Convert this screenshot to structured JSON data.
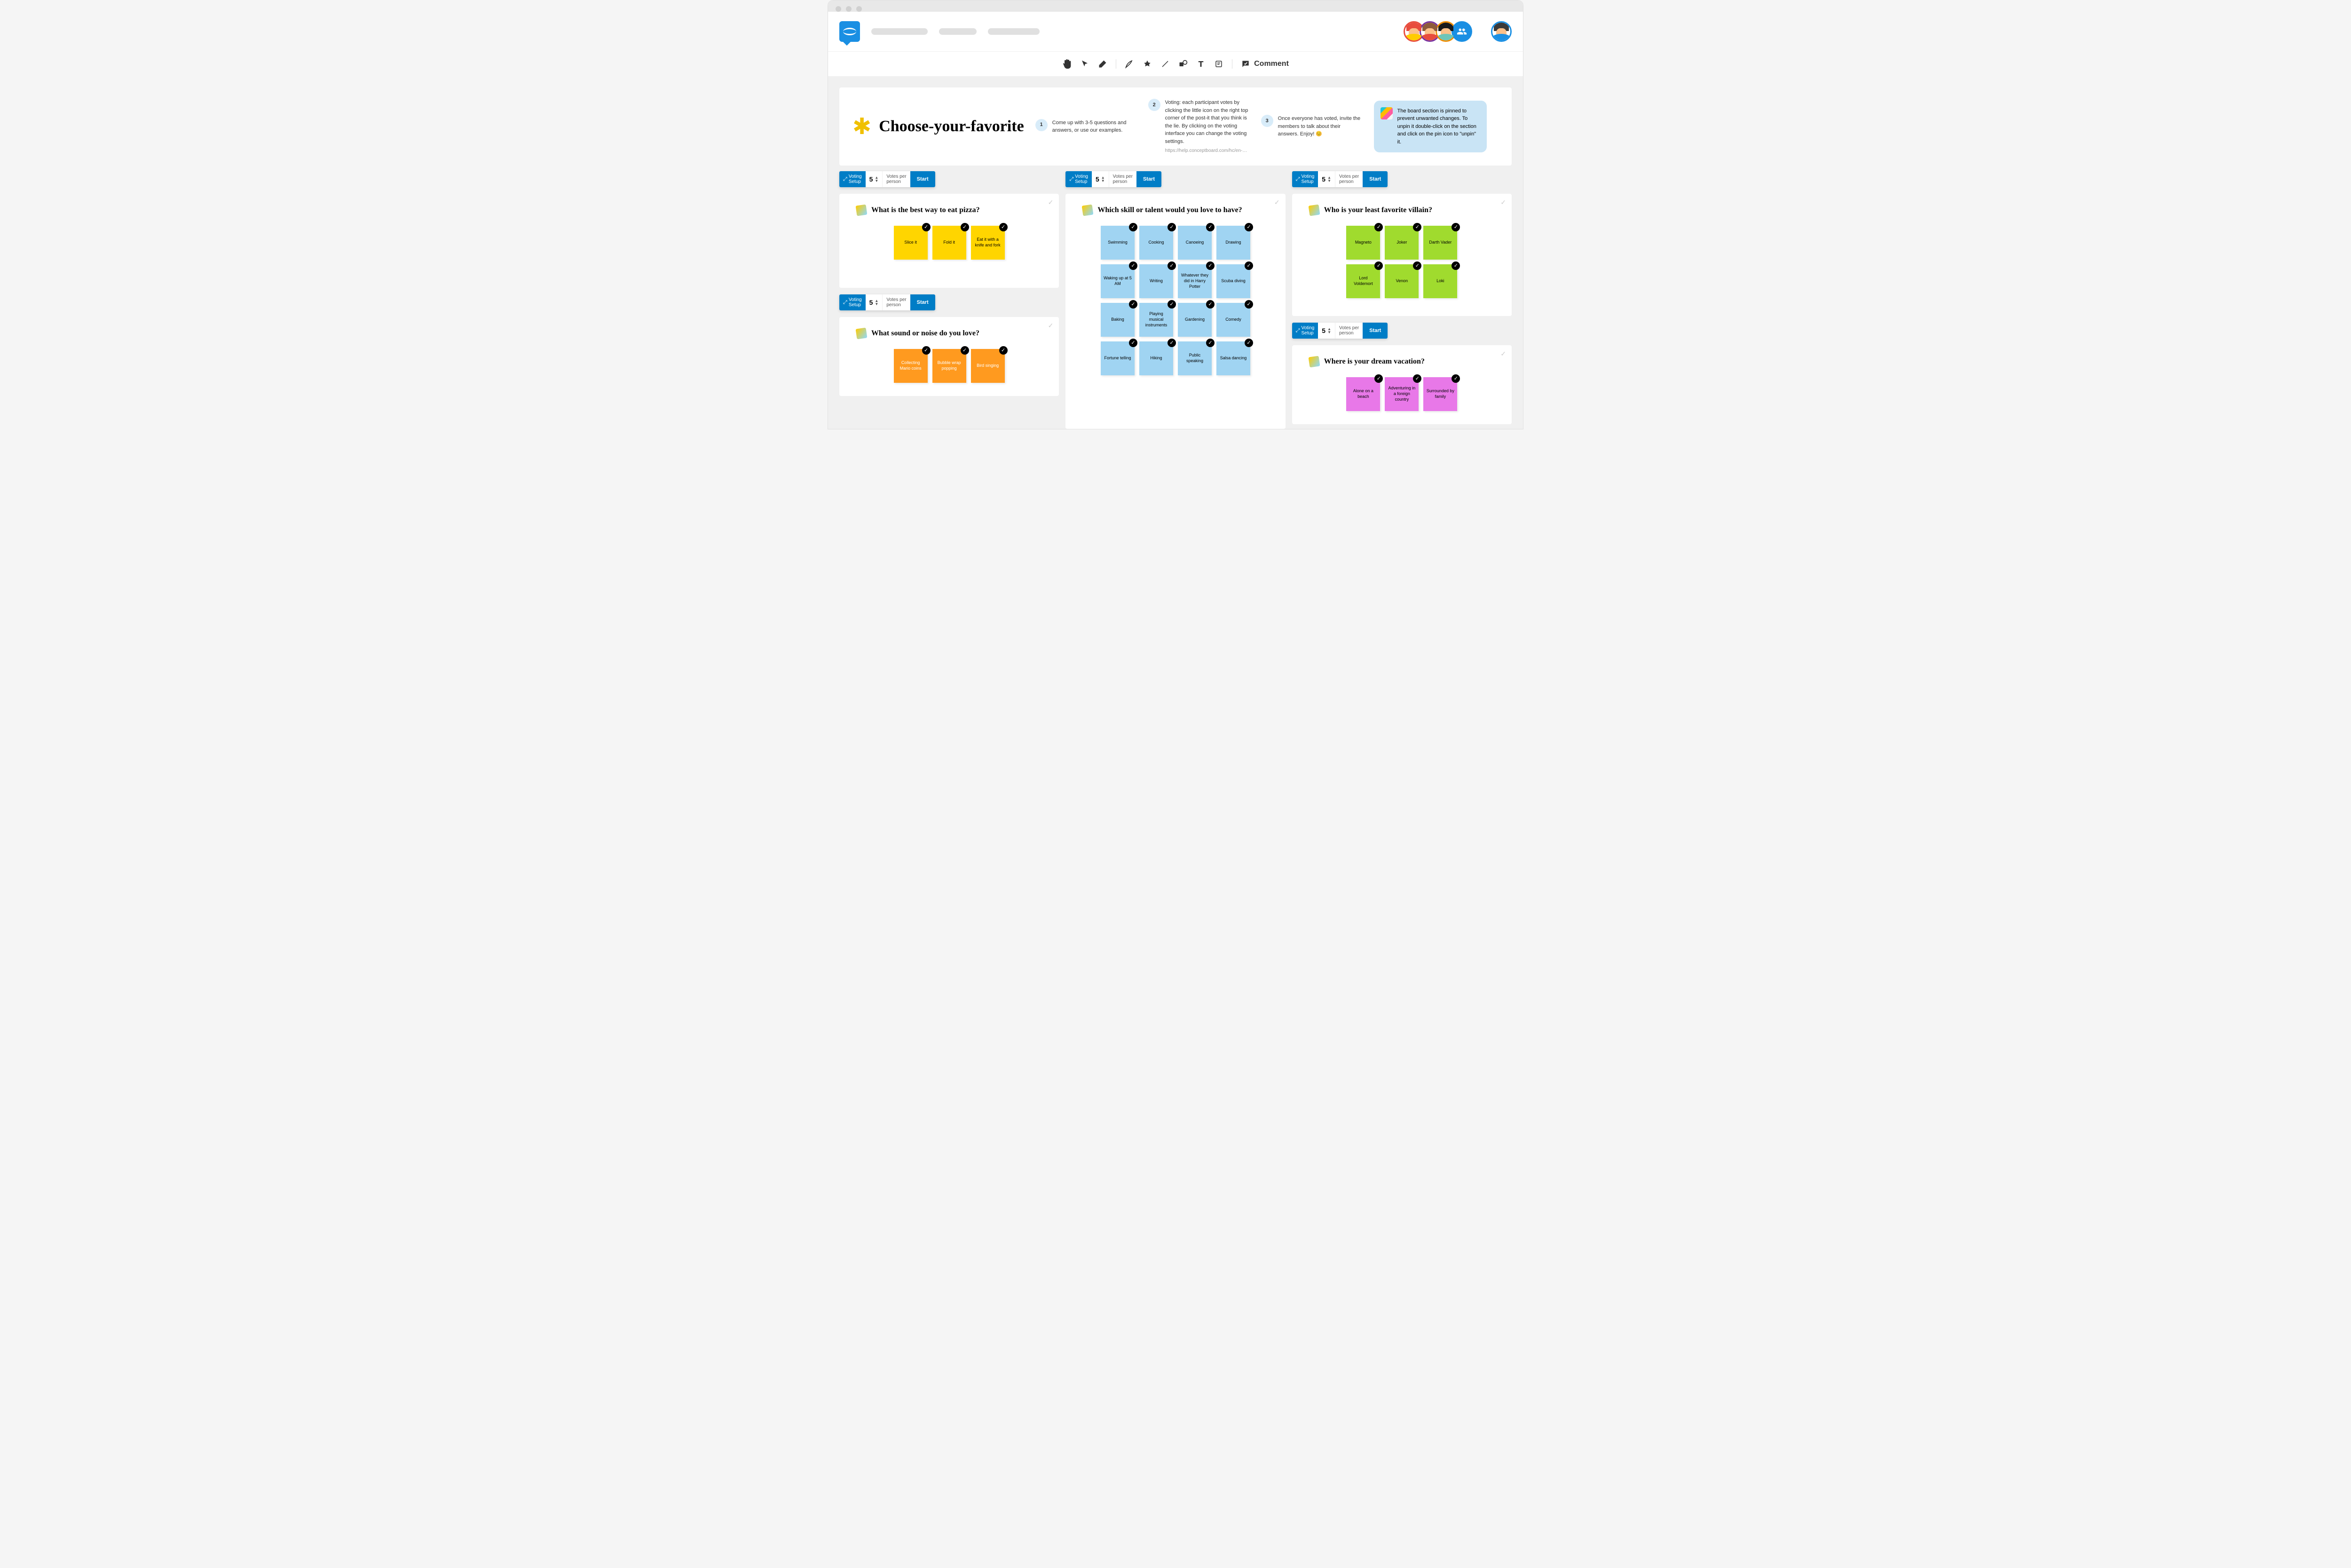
{
  "board_title": "Choose-your-favorite",
  "instructions": [
    {
      "num": "1",
      "text": "Come up with 3-5 questions and answers, or use our examples."
    },
    {
      "num": "2",
      "text": "Voting: each participant votes by clicking the little icon on the right top corner of the post-it that you think is the lie. By clicking on the voting interface you can change the voting settings.",
      "link": "https://help.conceptboard.com/hc/en-us/..."
    },
    {
      "num": "3",
      "text": "Once everyone has voted, invite the members to talk about their answers. Enjoy! 😊"
    }
  ],
  "pin_notice": "The board section is pinned to prevent unwanted changes. To unpin it double-click on the section and click on the pin icon to \"unpin\" it.",
  "voting": {
    "setup_label": "Voting\nSetup",
    "count": "5",
    "per_label": "Votes per\nperson",
    "start": "Start"
  },
  "toolbar": {
    "comment": "Comment"
  },
  "sections": {
    "pizza": {
      "q": "What is the best way to eat pizza?",
      "notes": [
        "Slice it",
        "Fold it",
        "Eat it with a knife and fork"
      ]
    },
    "sound": {
      "q": "What sound or noise do you love?",
      "notes": [
        "Collecting Mario coins",
        "Bubble wrap popping",
        "Bird singing"
      ]
    },
    "skill": {
      "q": "Which skill or talent would you love to have?",
      "notes": [
        "Swimming",
        "Cooking",
        "Canoeing",
        "Drawing",
        "Waking up at 5 AM",
        "Writing",
        "Whatever they did in Harry Potter",
        "Scuba diving",
        "Baking",
        "Playing musical instruments",
        "Gardening",
        "Comedy",
        "Fortune telling",
        "Hiking",
        "Public speaking",
        "Salsa dancing"
      ]
    },
    "villain": {
      "q": "Who is your least favorite villain?",
      "notes": [
        "Magneto",
        "Joker",
        "Darth Vader",
        "Lord Voldemort",
        "Venon",
        "Loki"
      ]
    },
    "vacation": {
      "q": "Where is your dream vacation?",
      "notes": [
        "Alone on a beach",
        "Adventuring in a foreign country",
        "Surrounded by family"
      ]
    }
  }
}
